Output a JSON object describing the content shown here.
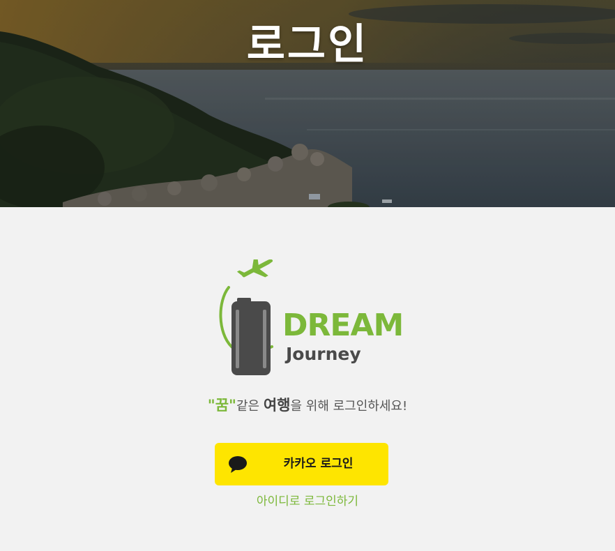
{
  "hero": {
    "title": "로그인"
  },
  "logo": {
    "primary": "DREAM",
    "secondary": "Journey"
  },
  "tagline": {
    "dream_word": "\"꿈\"",
    "part1": "같은 ",
    "travel_word": "여행",
    "part2": "을 위해 로그인하세요!"
  },
  "kakao_button": {
    "label": "카카오 로그인",
    "icon": "chat-bubble-icon"
  },
  "id_login_link": {
    "label": "아이디로 로그인하기"
  },
  "colors": {
    "brand_green": "#7cb83a",
    "logo_gray": "#4a4a4a",
    "kakao_yellow": "#fee500",
    "background": "#f2f2f2"
  }
}
